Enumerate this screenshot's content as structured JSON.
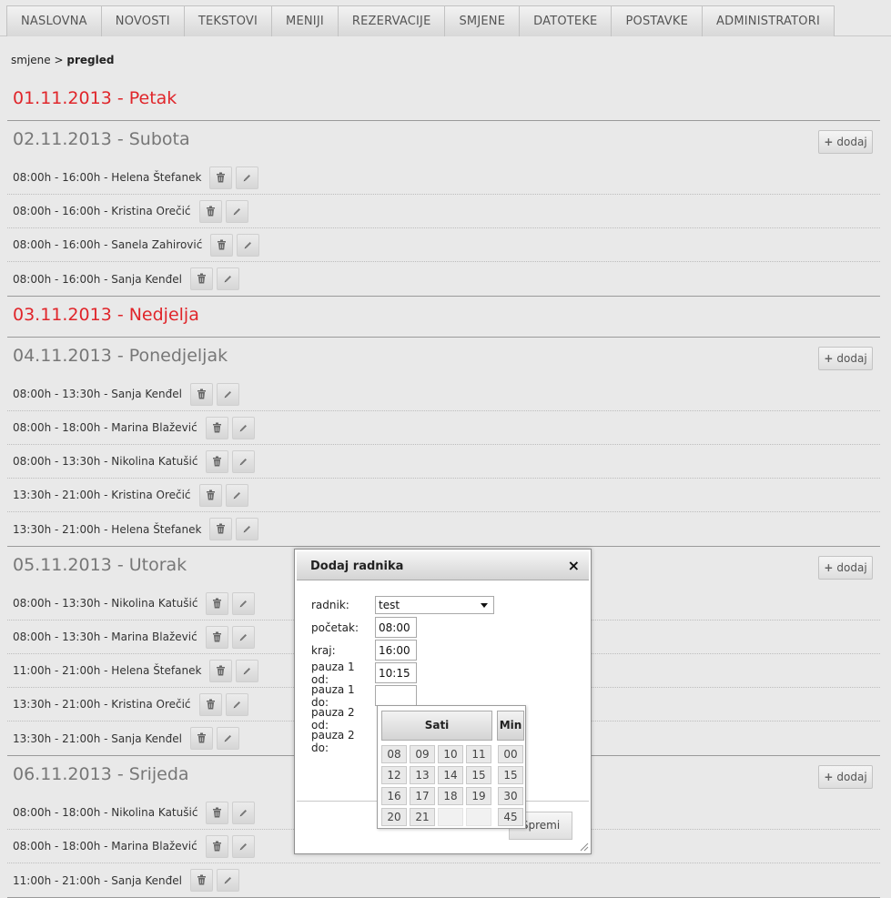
{
  "nav": {
    "tabs": [
      "NASLOVNA",
      "NOVOSTI",
      "TEKSTOVI",
      "MENIJI",
      "REZERVACIJE",
      "SMJENE",
      "DATOTEKE",
      "POSTAVKE",
      "ADMINISTRATORI"
    ]
  },
  "breadcrumb": {
    "parent": "smjene",
    "separator": ">",
    "current": "pregled"
  },
  "add_label": "dodaj",
  "days": [
    {
      "title": "01.11.2013 - Petak",
      "weekend": true,
      "shifts": []
    },
    {
      "title": "02.11.2013 - Subota",
      "weekend": false,
      "shifts": [
        "08:00h - 16:00h - Helena Štefanek",
        "08:00h - 16:00h - Kristina Orečić",
        "08:00h - 16:00h - Sanela Zahirović",
        "08:00h - 16:00h - Sanja Kenđel"
      ]
    },
    {
      "title": "03.11.2013 - Nedjelja",
      "weekend": true,
      "shifts": []
    },
    {
      "title": "04.11.2013 - Ponedjeljak",
      "weekend": false,
      "shifts": [
        "08:00h - 13:30h - Sanja Kenđel",
        "08:00h - 18:00h - Marina Blažević",
        "08:00h - 13:30h - Nikolina Katušić",
        "13:30h - 21:00h - Kristina Orečić",
        "13:30h - 21:00h - Helena Štefanek"
      ]
    },
    {
      "title": "05.11.2013 - Utorak",
      "weekend": false,
      "shifts": [
        "08:00h - 13:30h - Nikolina Katušić",
        "08:00h - 13:30h - Marina Blažević",
        "11:00h - 21:00h - Helena Štefanek",
        "13:30h - 21:00h - Kristina Orečić",
        "13:30h - 21:00h - Sanja Kenđel"
      ]
    },
    {
      "title": "06.11.2013 - Srijeda",
      "weekend": false,
      "shifts": [
        "08:00h - 18:00h - Nikolina Katušić",
        "08:00h - 18:00h - Marina Blažević",
        "11:00h - 21:00h - Sanja Kenđel"
      ]
    }
  ],
  "dialog": {
    "title": "Dodaj radnika",
    "close": "×",
    "fields": {
      "radnik": {
        "label": "radnik:",
        "value": "test"
      },
      "pocetak": {
        "label": "početak:",
        "value": "08:00"
      },
      "kraj": {
        "label": "kraj:",
        "value": "16:00"
      },
      "pauza1od": {
        "label": "pauza 1 od:",
        "value": "10:15"
      },
      "pauza1do": {
        "label": "pauza 1 do:",
        "value": ""
      },
      "pauza2od": {
        "label": "pauza 2 od:",
        "value": ""
      },
      "pauza2do": {
        "label": "pauza 2 do:",
        "value": ""
      }
    },
    "save_label": "Spremi"
  },
  "picker": {
    "hours_label": "Sati",
    "minutes_label": "Min",
    "hours": [
      "08",
      "09",
      "10",
      "11",
      "12",
      "13",
      "14",
      "15",
      "16",
      "17",
      "18",
      "19",
      "20",
      "21"
    ],
    "minutes": [
      "00",
      "15",
      "30",
      "45"
    ]
  },
  "colors": {
    "weekend": "#e0252a",
    "weekday": "#777777"
  }
}
